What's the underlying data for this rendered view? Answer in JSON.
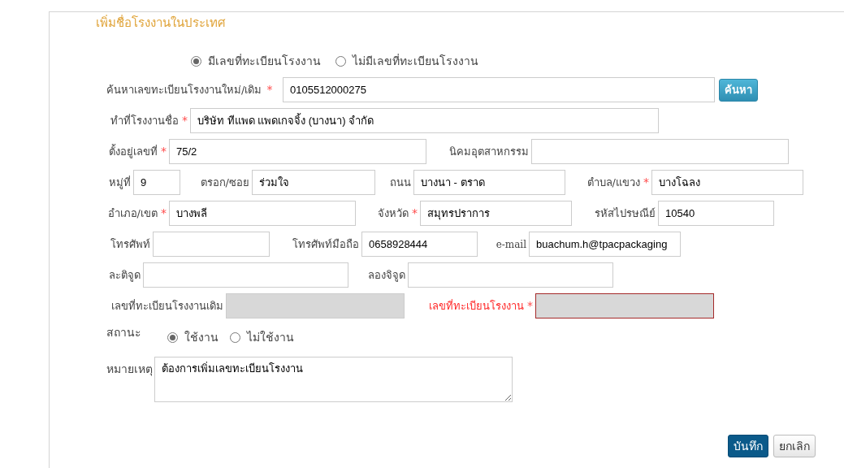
{
  "title": "เพิ่มชื่อโรงงานในประเทศ",
  "registration_options": [
    {
      "label": "มีเลขที่ทะเบียนโรงงาน",
      "selected": true
    },
    {
      "label": "ไม่มีเลขที่ทะเบียนโรงงาน",
      "selected": false
    }
  ],
  "rows": [
    {
      "fields": [
        {
          "label": "ค้นหาเลขทะเบียนโรงงานใหม่/เดิม",
          "mark": "*",
          "value": "0105512000275",
          "disabled": false,
          "error": false
        }
      ],
      "button": "ค้นหา"
    },
    {
      "fields": [
        {
          "label": "ทำที่โรงงานชื่อ",
          "mark": "*",
          "value": "บริษัท ทีแพด แพดเกจจิ้ง (บางนา) จำกัด",
          "disabled": false,
          "error": false
        }
      ]
    },
    {
      "fields": [
        {
          "label": "ตั้งอยู่เลขที่",
          "mark": "*",
          "value": "75/2",
          "disabled": false,
          "error": false
        },
        {
          "label": "นิคมอุตสาหกรรม",
          "disabled": false,
          "error": false
        }
      ]
    },
    {
      "fields": [
        {
          "label": "หมู่ที่",
          "value": "9",
          "disabled": false,
          "error": false
        },
        {
          "label": "ตรอก/ซอย",
          "value": "ร่วมใจ",
          "disabled": false,
          "error": false
        },
        {
          "label": "ถนน",
          "value": "บางนา - ตราด",
          "disabled": false,
          "error": false
        },
        {
          "label": "ตำบล/แขวง",
          "mark": "*",
          "value": "บางโฉลง",
          "disabled": false,
          "error": false
        }
      ]
    },
    {
      "fields": [
        {
          "label": "อำเภอ/เขต",
          "mark": "*",
          "value": "บางพลี",
          "disabled": false,
          "error": false
        },
        {
          "label": "จังหวัด",
          "mark": "*",
          "value": "สมุทรปราการ",
          "disabled": false,
          "error": false
        },
        {
          "label": "รหัสไปรษณีย์",
          "value": "10540",
          "disabled": false,
          "error": false
        }
      ]
    },
    {
      "fields": [
        {
          "label": "โทรศัพท์",
          "disabled": false,
          "error": false
        },
        {
          "label": "โทรศัพท์มือถือ",
          "value": "0658928444",
          "disabled": false,
          "error": false
        },
        {
          "label": "e-mail",
          "value": "buachum.h@tpacpackaging",
          "disabled": false,
          "error": false
        }
      ]
    },
    {
      "fields": [
        {
          "label": "ละติจูด",
          "disabled": false,
          "error": false
        },
        {
          "label": "ลองจิจูด",
          "disabled": false,
          "error": false
        }
      ]
    },
    {
      "fields": [
        {
          "label": "เลขที่ทะเบียนโรงงานเดิม",
          "disabled": true,
          "error": false
        },
        {
          "label": "เลขที่ทะเบียนโรงงาน",
          "mark": "*",
          "disabled": true,
          "error": true
        }
      ]
    }
  ],
  "status": {
    "label": "สถานะ",
    "options": [
      {
        "label": "ใช้งาน",
        "selected": true
      },
      {
        "label": "ไม่ใช้งาน",
        "selected": false
      }
    ]
  },
  "remark": {
    "label": "หมายเหตุ",
    "value": "ต้องการเพิ่มเลขทะเบียนโรงงาน"
  },
  "buttons": [
    {
      "label": "บันทึก",
      "kind": "primary"
    },
    {
      "label": "ยกเลิก",
      "kind": "default"
    }
  ]
}
